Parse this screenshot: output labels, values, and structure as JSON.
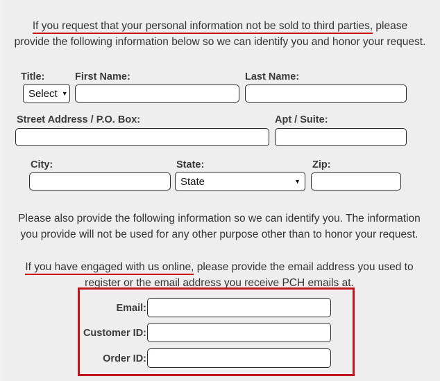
{
  "theme": {
    "background": "#eeeeee",
    "text": "#333333",
    "label": "#3a3a3a",
    "underline_red": "#cc1111",
    "box_red": "#c0161b",
    "input_bg": "#ffffff",
    "input_border": "#2b2b2b"
  },
  "intro": {
    "emphasis": "If you request that your personal information not be sold to third parties,",
    "rest": " please provide the following information below so we can identify you and honor your request."
  },
  "identity_form": {
    "title": {
      "label": "Title:",
      "value": "Select",
      "caret": "chevron-down-icon",
      "placeholder": "Select"
    },
    "first_name": {
      "label": "First Name:",
      "value": "",
      "placeholder": ""
    },
    "last_name": {
      "label": "Last Name:",
      "value": "",
      "placeholder": ""
    },
    "street_address": {
      "label": "Street Address / P.O. Box:",
      "value": "",
      "placeholder": ""
    },
    "apt_suite": {
      "label": "Apt / Suite:",
      "value": "",
      "placeholder": ""
    },
    "city": {
      "label": "City:",
      "value": "",
      "placeholder": ""
    },
    "state": {
      "label": "State:",
      "value": "State",
      "caret": "chevron-down-icon",
      "placeholder": "State"
    },
    "zip": {
      "label": "Zip:",
      "value": "",
      "placeholder": ""
    }
  },
  "mid_paragraph": "Please also provide the following information so we can identify you. The information you provide will not be used for any other purpose other than to honor your request.",
  "email_paragraph": {
    "emphasis": "If you have engaged with us online,",
    "rest": " please provide the email address you used to register or the email address you receive PCH emails at."
  },
  "online_form": {
    "email": {
      "label": "Email:",
      "value": "",
      "placeholder": ""
    },
    "customer_id": {
      "label": "Customer ID:",
      "value": "",
      "placeholder": ""
    },
    "order_id": {
      "label": "Order ID:",
      "value": "",
      "placeholder": ""
    }
  }
}
